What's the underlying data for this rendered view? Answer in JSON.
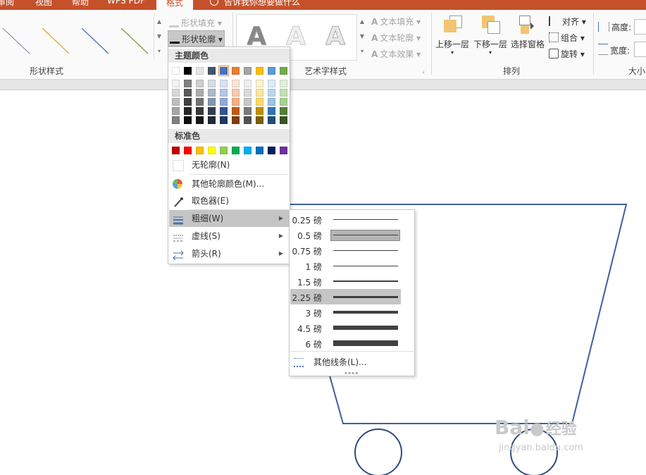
{
  "tabs": [
    {
      "label": "审阅"
    },
    {
      "label": "视图"
    },
    {
      "label": "帮助"
    },
    {
      "label": "WPS PDF"
    },
    {
      "label": "格式"
    },
    {
      "label": "告诉我你想要做什么"
    }
  ],
  "ribbon": {
    "shape_styles": {
      "label": "形状样式",
      "fill": "形状填充",
      "outline": "形状轮廓"
    },
    "wordart": {
      "label": "艺术字样式",
      "text_fill": "文本填充",
      "text_outline": "文本轮廓",
      "text_effect": "文本效果",
      "sample_letter": "A"
    },
    "arrange": {
      "label": "排列",
      "bring_forward": "上移一层",
      "send_backward": "下移一层",
      "selection_pane": "选择窗格",
      "align": "对齐",
      "group": "组合",
      "rotate": "旋转"
    },
    "size": {
      "label": "大小",
      "height": "高度:",
      "width": "宽度:"
    }
  },
  "color_menu": {
    "theme_colors_header": "主题颜色",
    "theme_top": [
      "#ffffff",
      "#000000",
      "#e7e6e6",
      "#44546a",
      "#4472c4",
      "#ed7d31",
      "#a5a5a5",
      "#ffc000",
      "#5b9bd5",
      "#70ad47"
    ],
    "theme_shades": [
      [
        "#f2f2f2",
        "#d9d9d9",
        "#bfbfbf",
        "#a6a6a6",
        "#808080"
      ],
      [
        "#808080",
        "#595959",
        "#404040",
        "#262626",
        "#0d0d0d"
      ],
      [
        "#d0cece",
        "#aeabab",
        "#757171",
        "#3b3838",
        "#161616"
      ],
      [
        "#d6dce5",
        "#adb9ca",
        "#8497b0",
        "#333f50",
        "#222a35"
      ],
      [
        "#d9e2f3",
        "#b4c7e7",
        "#8faadc",
        "#2f5597",
        "#1f3864"
      ],
      [
        "#fbe5d6",
        "#f8cbad",
        "#f4b183",
        "#c55a11",
        "#843c0c"
      ],
      [
        "#ededed",
        "#dbdbdb",
        "#c9c9c9",
        "#7b7b7b",
        "#525252"
      ],
      [
        "#fff2cc",
        "#ffe699",
        "#ffd966",
        "#bf9000",
        "#7f6000"
      ],
      [
        "#deebf7",
        "#bdd7ee",
        "#9dc3e6",
        "#2e75b6",
        "#1f4e79"
      ],
      [
        "#e2f0d9",
        "#c5e0b4",
        "#a9d18e",
        "#548235",
        "#385723"
      ]
    ],
    "standard_header": "标准色",
    "standard": [
      "#c00000",
      "#ff0000",
      "#ffc000",
      "#ffff00",
      "#92d050",
      "#00b050",
      "#00b0f0",
      "#0070c0",
      "#002060",
      "#7030a0"
    ],
    "no_outline": "无轮廓(N)",
    "more_colors": "其他轮廓颜色(M)...",
    "eyedropper": "取色器(E)",
    "weight": "粗细(W)",
    "dashes": "虚线(S)",
    "arrows": "箭头(R)"
  },
  "weight_menu": {
    "items": [
      {
        "label": "0.25 磅",
        "pt": 0.25
      },
      {
        "label": "0.5 磅",
        "pt": 0.5
      },
      {
        "label": "0.75 磅",
        "pt": 0.75
      },
      {
        "label": "1 磅",
        "pt": 1
      },
      {
        "label": "1.5 磅",
        "pt": 1.5
      },
      {
        "label": "2.25 磅",
        "pt": 2.25
      },
      {
        "label": "3 磅",
        "pt": 3
      },
      {
        "label": "4.5 磅",
        "pt": 4.5
      },
      {
        "label": "6 磅",
        "pt": 6
      }
    ],
    "more_lines": "其他线条(L)..."
  },
  "colors": {
    "accent_tab": "#c5512b",
    "shape_stroke": "#3f5f9c",
    "wheel_stroke": "#2f4a80"
  },
  "watermark": {
    "brand_left": "Bai",
    "brand_right": "经验",
    "url": "jingyan.baidu.com"
  }
}
